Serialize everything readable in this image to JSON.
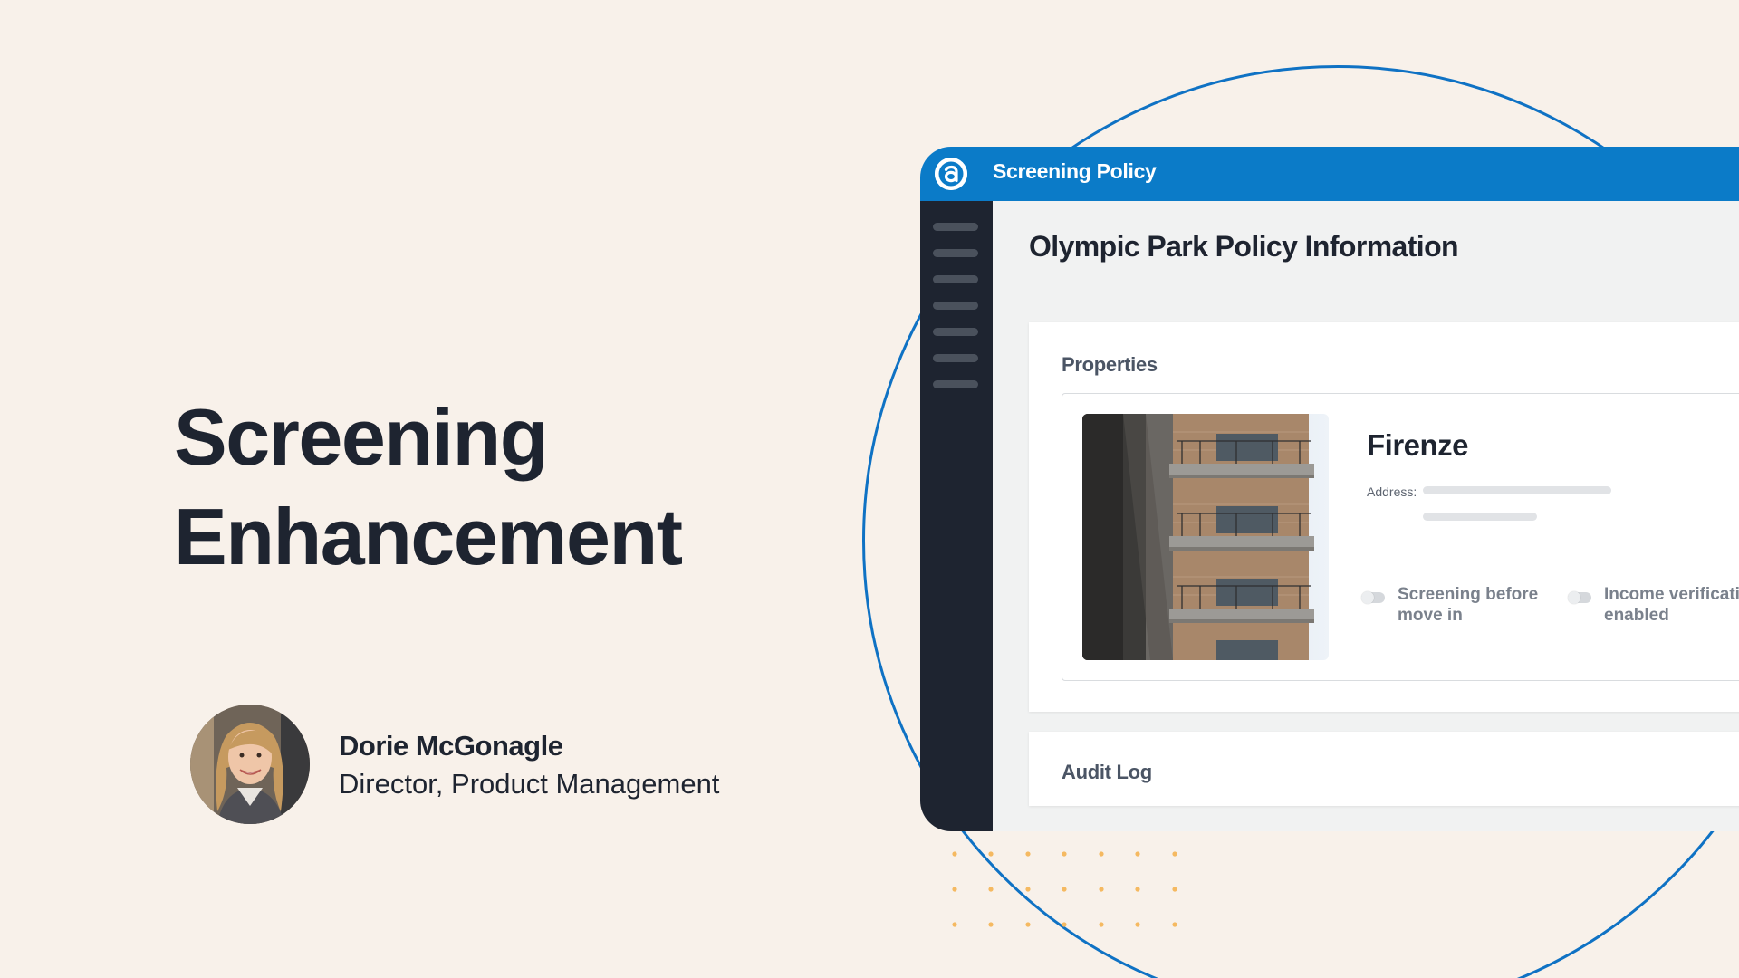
{
  "slide": {
    "title_line1": "Screening",
    "title_line2": "Enhancement"
  },
  "presenter": {
    "name": "Dorie McGonagle",
    "role": "Director, Product Management"
  },
  "app": {
    "header_title": "Screening Policy",
    "page_title": "Olympic Park Policy Information",
    "properties_label": "Properties",
    "property": {
      "name": "Firenze",
      "address_label": "Address:",
      "toggles": [
        {
          "line1": "Screening before",
          "line2": "move in"
        },
        {
          "line1": "Income verificati",
          "line2": "enabled"
        }
      ]
    },
    "audit_log_label": "Audit Log"
  },
  "colors": {
    "background": "#f8f1ea",
    "brand_blue": "#0b7bc8",
    "sidebar": "#1e2430",
    "dot_accent": "#f5b961"
  },
  "icons": {
    "app_logo": "appfolio-logo-icon",
    "menu_lines": "sidebar-menu-icon"
  }
}
